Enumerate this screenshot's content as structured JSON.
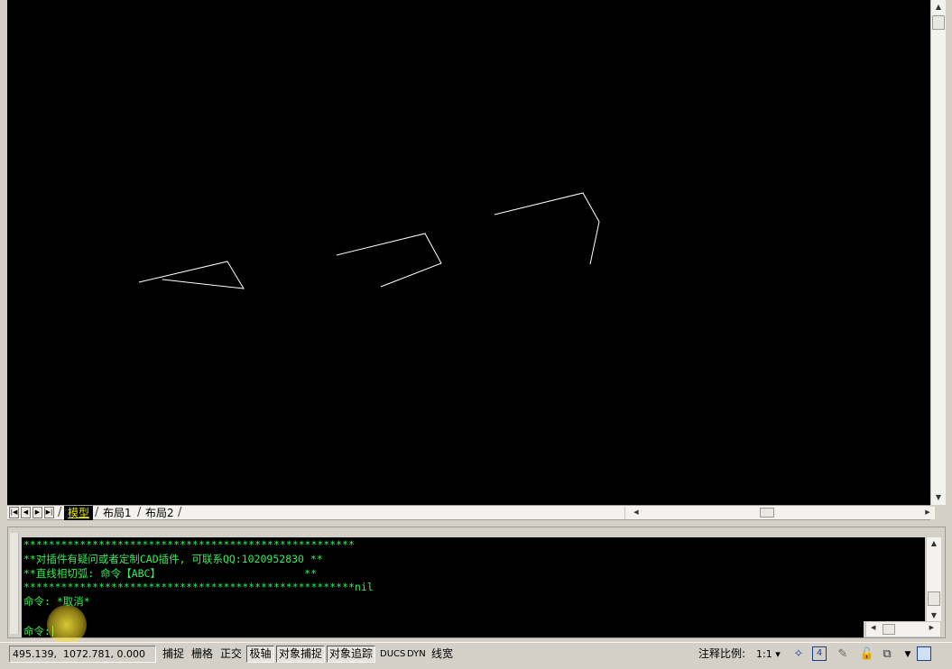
{
  "tabs": [
    {
      "label": "模型",
      "active": true
    },
    {
      "label": "布局1",
      "active": false
    },
    {
      "label": "布局2",
      "active": false
    }
  ],
  "command_history": [
    "*****************************************************",
    "**对插件有疑问或者定制CAD插件, 可联系QQ:1020952830 **",
    "**直线相切弧: 命令【ABC】                       **",
    "*****************************************************nil",
    "命令: *取消*"
  ],
  "command_prompt": "命令:",
  "status": {
    "coordinates": "495.139,  1072.781, 0.000",
    "toggles": [
      {
        "label": "捕捉",
        "on": false
      },
      {
        "label": "栅格",
        "on": false
      },
      {
        "label": "正交",
        "on": false
      },
      {
        "label": "极轴",
        "on": true
      },
      {
        "label": "对象捕捉",
        "on": true
      },
      {
        "label": "对象追踪",
        "on": true
      },
      {
        "label": "DUCS",
        "on": false
      },
      {
        "label": "DYN",
        "on": false
      },
      {
        "label": "线宽",
        "on": false
      }
    ],
    "annotation_scale_label": "注释比例:",
    "annotation_scale_value": "1:1",
    "icons": [
      "annotation-visibility-icon",
      "auto-scale-icon",
      "workspace-icon",
      "lock-icon",
      "isolate-objects-icon",
      "statusbar-menu-icon",
      "clean-screen-icon"
    ]
  },
  "colors": {
    "canvas_bg": "#000000",
    "line": "#ffffff",
    "command_text": "#33ee55",
    "active_tab_text": "#e8e800"
  }
}
